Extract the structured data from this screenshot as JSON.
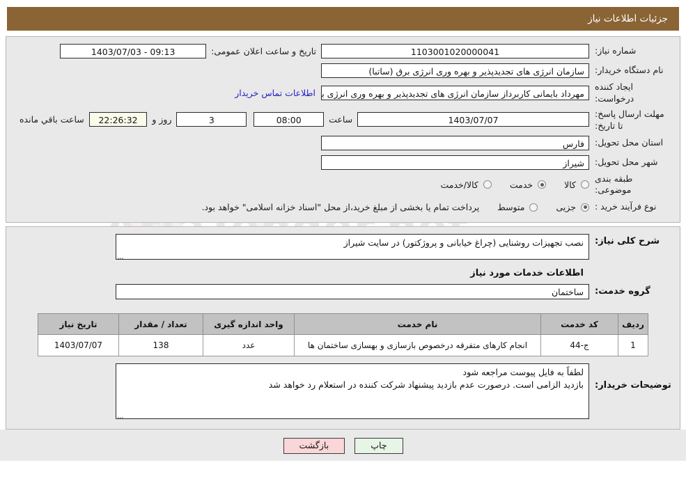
{
  "header": {
    "title": "جزئیات اطلاعات نیاز",
    "bar_color": "#8a6434"
  },
  "top_form": {
    "need_number": {
      "label": "شماره نیاز:",
      "value": "1103001020000041"
    },
    "announce_datetime": {
      "label": "تاریخ و ساعت اعلان عمومی:",
      "value": "1403/07/03 - 09:13"
    },
    "buyer_org": {
      "label": "نام دستگاه خریدار:",
      "value": "سازمان انرژی های تجدیدپذیر و بهره وری انرژی برق (ساتبا)"
    },
    "creator": {
      "label": "ایجاد کننده درخواست:",
      "value": "مهرداد بایمانی کاربرداز سازمان انرژی های تجدیدپذیر و بهره وری انرژی برق (ساتبا)"
    },
    "contact_link": "اطلاعات تماس خریدار",
    "deadline": {
      "label": "مهلت ارسال پاسخ: تا تاریخ:",
      "date": "1403/07/07",
      "hour_label": "ساعت",
      "hour": "08:00",
      "days": "3",
      "days_label": "روز و",
      "remaining": "22:26:32",
      "remaining_label": "ساعت باقي مانده"
    },
    "province": {
      "label": "استان محل تحویل:",
      "value": "فارس"
    },
    "city": {
      "label": "شهر محل تحویل:",
      "value": "شیراز"
    },
    "category": {
      "label": "طبقه بندی موضوعی:",
      "options": [
        {
          "label": "کالا",
          "selected": false
        },
        {
          "label": "خدمت",
          "selected": true
        },
        {
          "label": "کالا/خدمت",
          "selected": false
        }
      ]
    },
    "process_type": {
      "label": "نوع فرآیند خرید :",
      "options": [
        {
          "label": "جزیی",
          "selected": true
        },
        {
          "label": "متوسط",
          "selected": false
        }
      ],
      "note": "پرداخت تمام یا بخشی از مبلغ خرید،از محل \"اسناد خزانه اسلامی\" خواهد بود."
    }
  },
  "detail": {
    "general_desc_label": "شرح کلی نیاز:",
    "general_desc_value": "نصب تجهیزات روشنایی (چراغ خیابانی و پروژکتور) در سایت شیراز",
    "section_title": "اطلاعات خدمات مورد نیاز",
    "service_group_label": "گروه خدمت:",
    "service_group_value": "ساختمان"
  },
  "items_table": {
    "columns": [
      "ردیف",
      "کد خدمت",
      "نام خدمت",
      "واحد اندازه گیری",
      "تعداد / مقدار",
      "تاریخ نیاز"
    ],
    "rows": [
      {
        "row": "1",
        "code": "ج-44",
        "name": "انجام کارهای متفرقه درخصوص بازسازی و بهسازی ساختمان ها",
        "unit": "عدد",
        "qty": "138",
        "date": "1403/07/07"
      }
    ]
  },
  "buyer_notes": {
    "label": "توضیحات خریدار:",
    "line1": "لطفاً به فایل پیوست مراجعه شود",
    "line2": "بازدید الزامی است. درصورت عدم بازدید پیشنهاد شرکت کننده در استعلام رد خواهد شد"
  },
  "buttons": {
    "print": "چاپ",
    "back": "بازگشت"
  },
  "watermark": {
    "text": "AriaTender.net"
  }
}
